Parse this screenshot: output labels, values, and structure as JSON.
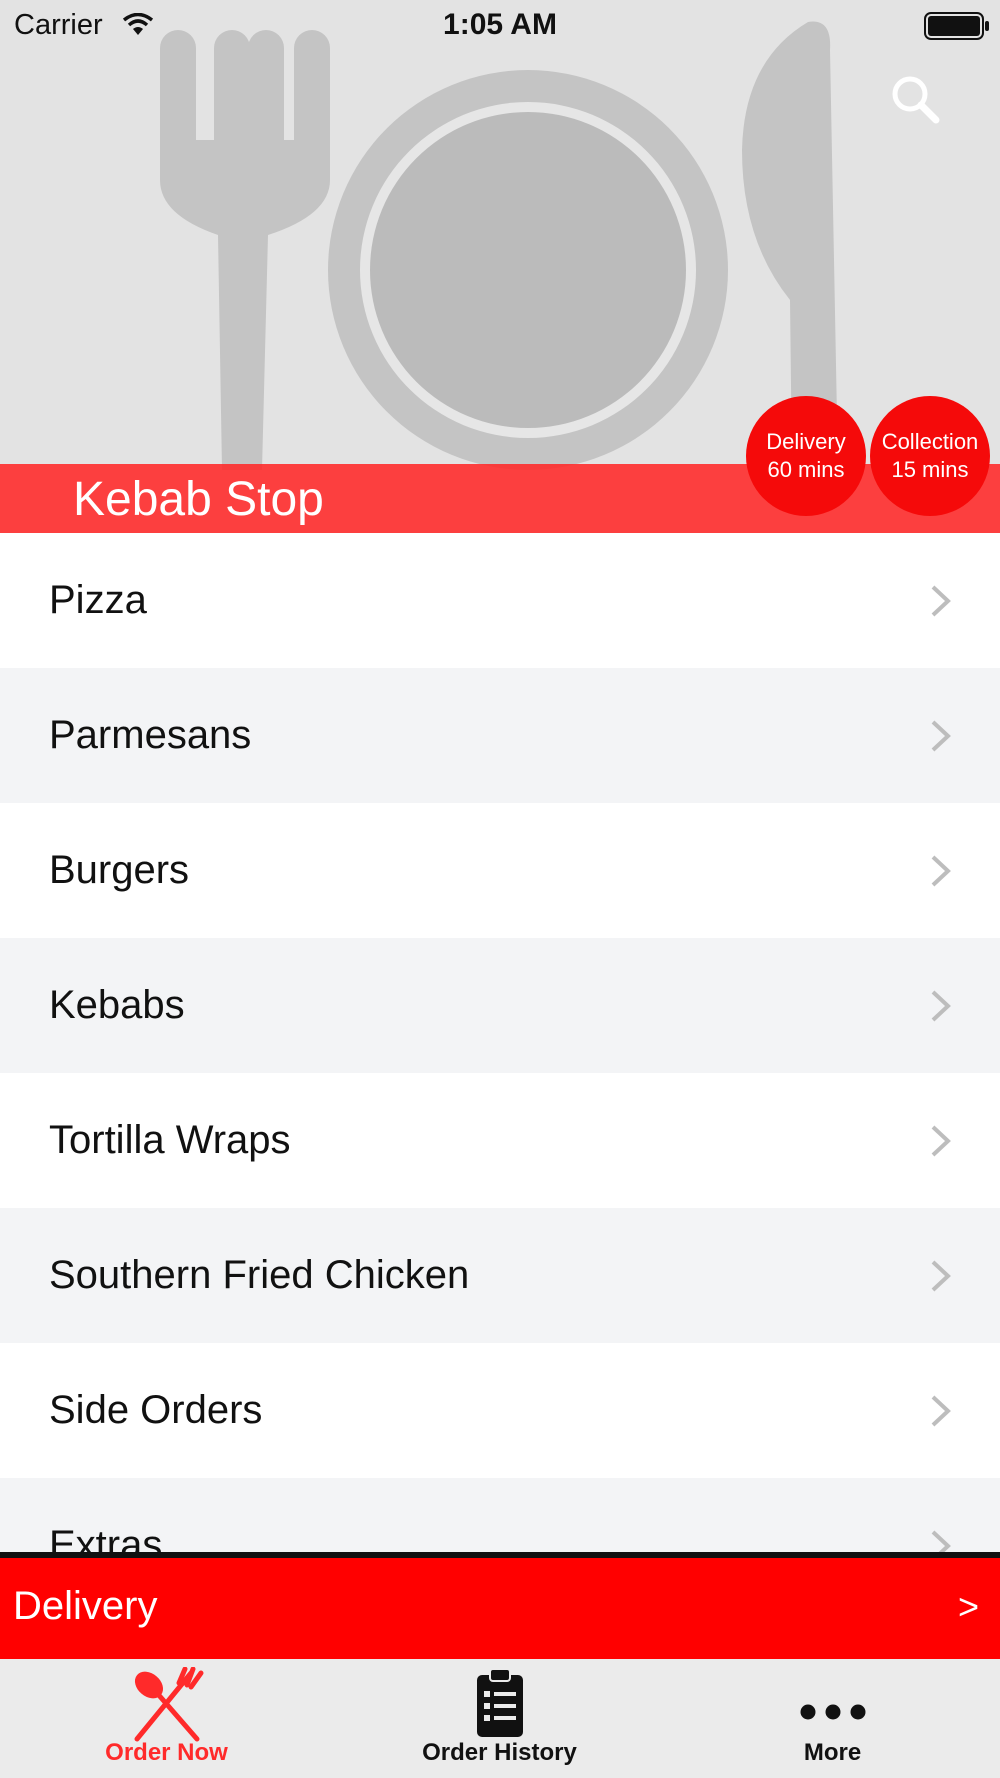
{
  "status_bar": {
    "carrier": "Carrier",
    "time": "1:05 AM"
  },
  "header": {
    "restaurant_name": "Kebab Stop",
    "search_icon": "search-icon",
    "delivery_badge": {
      "line1": "Delivery",
      "line2": "60 mins"
    },
    "collection_badge": {
      "line1": "Collection",
      "line2": "15 mins"
    }
  },
  "menu": {
    "items": [
      {
        "label": "Pizza"
      },
      {
        "label": "Parmesans"
      },
      {
        "label": "Burgers"
      },
      {
        "label": "Kebabs"
      },
      {
        "label": "Tortilla Wraps"
      },
      {
        "label": "Southern Fried Chicken"
      },
      {
        "label": "Side Orders"
      },
      {
        "label": "Extras"
      }
    ]
  },
  "order_bar": {
    "mode": "Delivery",
    "arrow": ">"
  },
  "tabbar": {
    "tabs": [
      {
        "label": "Order Now",
        "icon": "fork-spoon-icon",
        "active": true
      },
      {
        "label": "Order History",
        "icon": "clipboard-icon",
        "active": false
      },
      {
        "label": "More",
        "icon": "more-dots-icon",
        "active": false
      }
    ]
  },
  "colors": {
    "accent_red": "#ff0000",
    "active_tab": "#ff2a2a",
    "header_bg": "#e3e3e3"
  }
}
